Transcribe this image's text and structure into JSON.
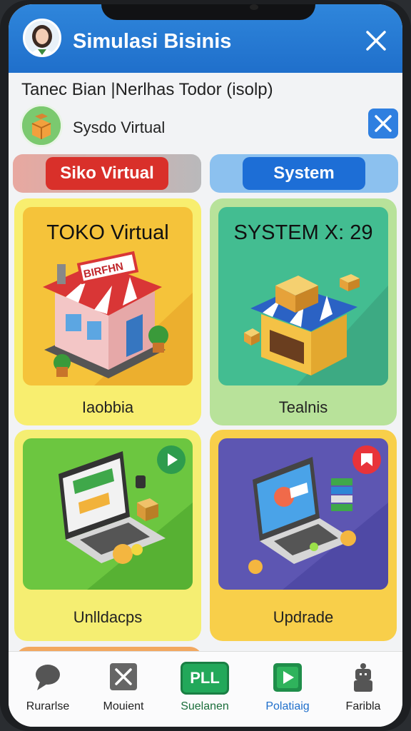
{
  "header": {
    "title": "Simulasi Bisinis"
  },
  "subtitle": "Tanec Bian |Nerlhas Todor (isolp)",
  "profile": {
    "name": "Sysdo Virtual"
  },
  "tabs": [
    {
      "label": "Siko Virtual",
      "color": "#d9302a"
    },
    {
      "label": "System",
      "color": "#1d6ed6"
    }
  ],
  "cards": [
    {
      "title": "TOKO Virtual",
      "sign": "BIRFHN",
      "label": "Iaobbia"
    },
    {
      "title": "SYSTEM X: 29",
      "label": "Tealnis"
    },
    {
      "label": "Unlldacps"
    },
    {
      "label": "Updrade"
    }
  ],
  "nav": [
    {
      "label": "Rurarlse",
      "icon": "chat-bubble-icon"
    },
    {
      "label": "Mouient",
      "icon": "close-box-icon"
    },
    {
      "label": "Suelanen",
      "icon": "pll-icon",
      "badge": "PLL"
    },
    {
      "label": "Polatiaig",
      "icon": "play-icon"
    },
    {
      "label": "Faribla",
      "icon": "robot-icon"
    }
  ]
}
